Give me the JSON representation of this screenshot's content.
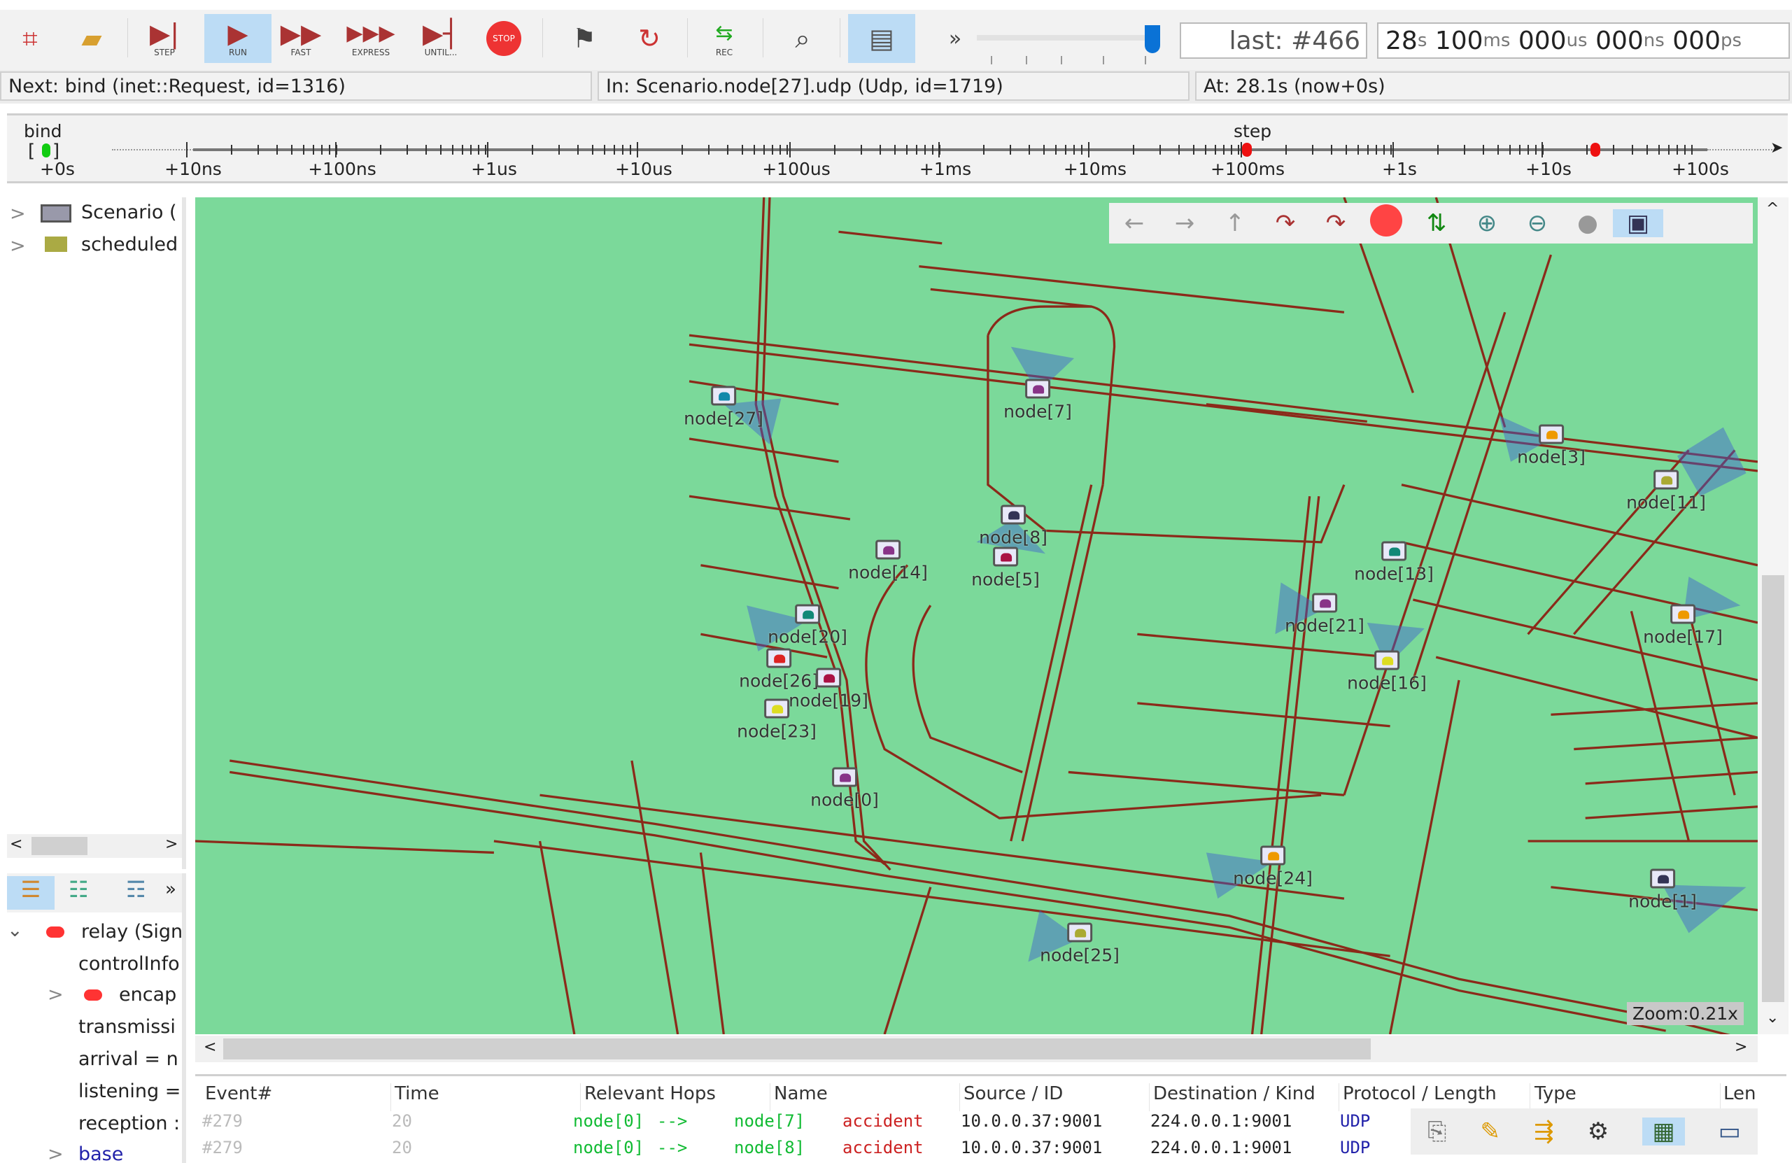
{
  "toolbar": {
    "items": [
      {
        "icon": "new-network-icon",
        "label": ""
      },
      {
        "icon": "load-config-icon",
        "label": ""
      },
      {
        "icon": "step-icon",
        "label": "STEP"
      },
      {
        "icon": "run-icon",
        "label": "RUN"
      },
      {
        "icon": "fast-icon",
        "label": "FAST"
      },
      {
        "icon": "express-icon",
        "label": "EXPRESS"
      },
      {
        "icon": "until-icon",
        "label": "UNTIL..."
      },
      {
        "icon": "stop-icon",
        "label": "STOP"
      },
      {
        "icon": "finish-flag-icon",
        "label": ""
      },
      {
        "icon": "rebuild-icon",
        "label": ""
      },
      {
        "icon": "record-icon",
        "label": "REC"
      },
      {
        "icon": "search-icon",
        "label": ""
      },
      {
        "icon": "layout-icon",
        "label": ""
      }
    ],
    "more": "»",
    "last_event": "last: #466",
    "sim_time": {
      "s": "28",
      "s_u": "s",
      "ms": "100",
      "ms_u": "ms",
      "us": "000",
      "us_u": "us",
      "ns": "000",
      "ns_u": "ns",
      "ps": "000",
      "ps_u": "ps"
    }
  },
  "status": {
    "next": "Next: bind (inet::Request, id=1316)",
    "in": "In: Scenario.node[27].udp (Udp, id=1719)",
    "at": "At: 28.1s (now+0s)"
  },
  "timeline": {
    "labels": [
      "+0s",
      "+10ns",
      "+100ns",
      "+1us",
      "+10us",
      "+100us",
      "+1ms",
      "+10ms",
      "+100ms",
      "+1s",
      "+10s",
      "+100s"
    ],
    "bind_label": "bind",
    "step_label": "step"
  },
  "left_tree": {
    "items": [
      {
        "label": "Scenario (",
        "icon": "network-icon"
      },
      {
        "label": "scheduled",
        "icon": "queue-icon"
      }
    ]
  },
  "inspector": {
    "items": [
      "relay (Sign",
      "controlInfo",
      "encap",
      "transmissi",
      "arrival = n",
      "listening =",
      "reception :",
      "base"
    ],
    "more": "»"
  },
  "map": {
    "zoom": "Zoom:0.21x",
    "nodes": [
      "node[27]",
      "node[7]",
      "node[3]",
      "node[11]",
      "node[8]",
      "node[14]",
      "node[5]",
      "node[13]",
      "node[21]",
      "node[17]",
      "node[20]",
      "node[26]",
      "node[19]",
      "node[23]",
      "node[16]",
      "node[0]",
      "node[24]",
      "node[25]",
      "node[1]"
    ],
    "colors": {
      "background": "#7bd99a",
      "road": "#8b2a1a",
      "main_road": "#b33020"
    }
  },
  "table": {
    "headers": [
      "Event#",
      "Time",
      "Relevant Hops",
      "Name",
      "Source / ID",
      "Destination / Kind",
      "Protocol / Length",
      "Type",
      "Len"
    ],
    "rows": [
      {
        "event": "#279",
        "time": "20",
        "from": "node[0]",
        "arrow": "-->",
        "to": "node[7]",
        "name": "accident",
        "src": "10.0.0.37:9001",
        "dst": "224.0.0.1:9001",
        "proto": "UDP"
      },
      {
        "event": "#279",
        "time": "20",
        "from": "node[0]",
        "arrow": "-->",
        "to": "node[8]",
        "name": "accident",
        "src": "10.0.0.37:9001",
        "dst": "224.0.0.1:9001",
        "proto": "UDP"
      }
    ]
  }
}
